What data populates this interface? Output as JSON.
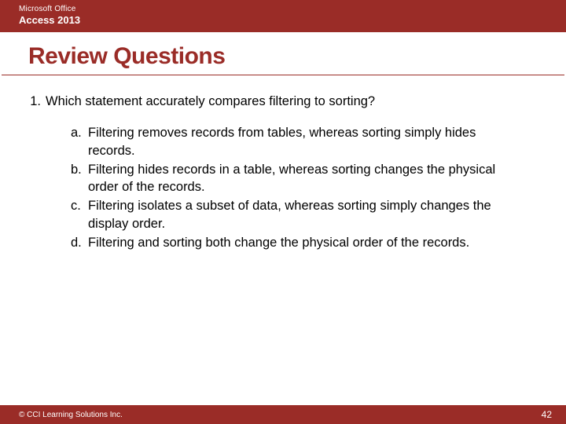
{
  "header": {
    "brand": "Microsoft Office",
    "product": "Access 2013"
  },
  "title": "Review Questions",
  "question": {
    "number": "1.",
    "stem": "Which statement accurately compares filtering to sorting?",
    "options": [
      {
        "letter": "a.",
        "text": "Filtering removes records from tables, whereas sorting simply hides records."
      },
      {
        "letter": "b.",
        "text": "Filtering hides records in a table, whereas sorting changes the physical order of the records."
      },
      {
        "letter": "c.",
        "text": "Filtering isolates a subset of data, whereas sorting simply changes the display order."
      },
      {
        "letter": "d.",
        "text": "Filtering and sorting both change the physical order of the records."
      }
    ]
  },
  "footer": {
    "copyright": "© CCI Learning Solutions Inc.",
    "page": "42"
  }
}
